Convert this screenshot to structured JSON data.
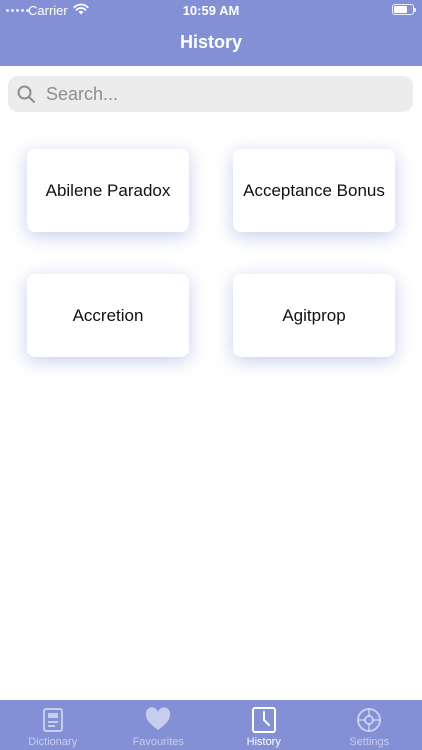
{
  "status_bar": {
    "carrier": "Carrier",
    "time": "10:59 AM"
  },
  "header": {
    "title": "History"
  },
  "search": {
    "placeholder": "Search..."
  },
  "history": {
    "items": [
      {
        "label": "Abilene Paradox"
      },
      {
        "label": "Acceptance Bonus"
      },
      {
        "label": "Accretion"
      },
      {
        "label": "Agitprop"
      }
    ]
  },
  "tabbar": {
    "tabs": [
      {
        "label": "Dictionary",
        "icon": "dictionary-icon",
        "active": false
      },
      {
        "label": "Favourites",
        "icon": "heart-icon",
        "active": false
      },
      {
        "label": "History",
        "icon": "clock-icon",
        "active": true
      },
      {
        "label": "Settings",
        "icon": "gear-icon",
        "active": false
      }
    ]
  },
  "colors": {
    "accent": "#8390d6",
    "search_bg": "#ececed",
    "card_shadow": "#8390d6"
  }
}
